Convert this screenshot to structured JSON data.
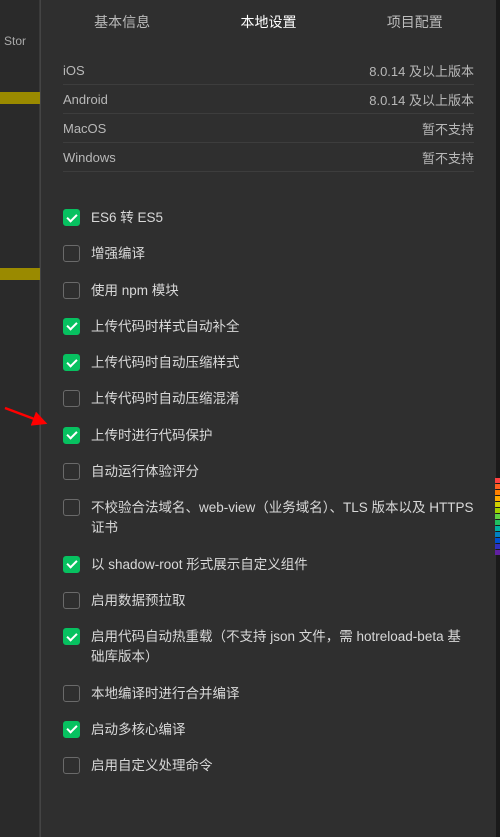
{
  "leftStrip": {
    "text": "Stor"
  },
  "tabs": {
    "basic": "基本信息",
    "local": "本地设置",
    "project": "项目配置"
  },
  "platforms": [
    {
      "name": "iOS",
      "value": "8.0.14 及以上版本"
    },
    {
      "name": "Android",
      "value": "8.0.14 及以上版本"
    },
    {
      "name": "MacOS",
      "value": "暂不支持"
    },
    {
      "name": "Windows",
      "value": "暂不支持"
    }
  ],
  "settings": [
    {
      "label": "ES6 转 ES5",
      "checked": true
    },
    {
      "label": "增强编译",
      "checked": false
    },
    {
      "label": "使用 npm 模块",
      "checked": false
    },
    {
      "label": "上传代码时样式自动补全",
      "checked": true
    },
    {
      "label": "上传代码时自动压缩样式",
      "checked": true
    },
    {
      "label": "上传代码时自动压缩混淆",
      "checked": false
    },
    {
      "label": "上传时进行代码保护",
      "checked": true
    },
    {
      "label": "自动运行体验评分",
      "checked": false
    },
    {
      "label": "不校验合法域名、web-view（业务域名）、TLS 版本以及 HTTPS 证书",
      "checked": false
    },
    {
      "label": "以 shadow-root 形式展示自定义组件",
      "checked": true
    },
    {
      "label": "启用数据预拉取",
      "checked": false
    },
    {
      "label": "启用代码自动热重载（不支持 json 文件，需 hotreload-beta 基础库版本）",
      "checked": true
    },
    {
      "label": "本地编译时进行合并编译",
      "checked": false
    },
    {
      "label": "启动多核心编译",
      "checked": true
    },
    {
      "label": "启用自定义处理命令",
      "checked": false
    }
  ],
  "meterColors": [
    "#ff4040",
    "#ff6020",
    "#ff8000",
    "#ffaa00",
    "#d0d000",
    "#a0d000",
    "#60d040",
    "#20c060",
    "#00b0a0",
    "#0080c0",
    "#0050d0",
    "#3030c0",
    "#6020a0"
  ]
}
